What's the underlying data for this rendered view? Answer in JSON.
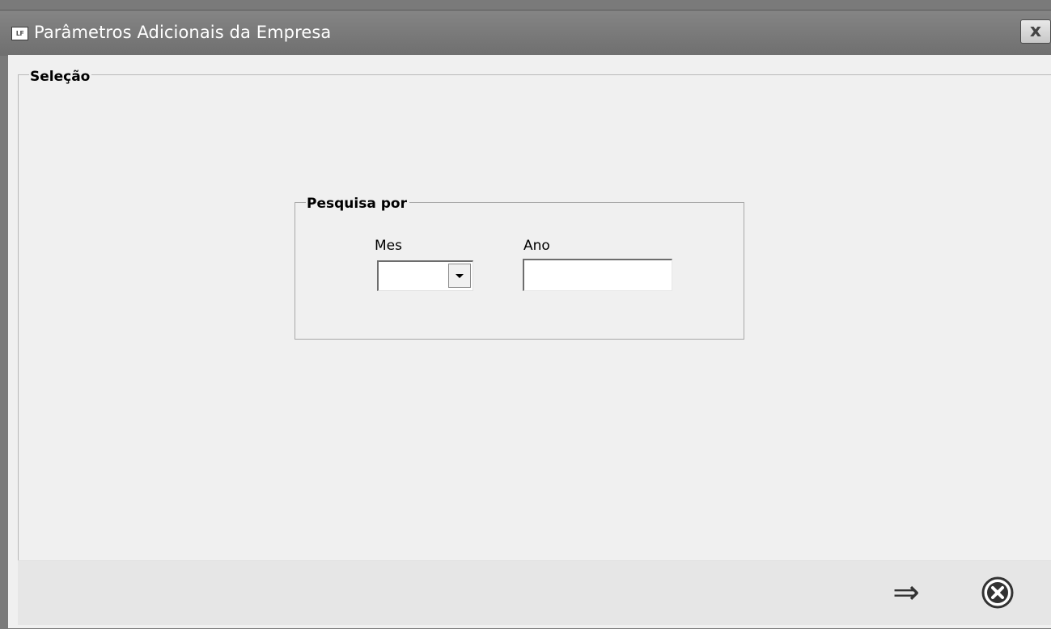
{
  "window": {
    "app_icon_text": "LF",
    "title": "Parâmetros Adicionais da Empresa",
    "close_label": "x"
  },
  "selection_group": {
    "legend": "Seleção",
    "search_group": {
      "legend": "Pesquisa por",
      "month": {
        "label": "Mes",
        "value": ""
      },
      "year": {
        "label": "Ano",
        "value": ""
      }
    }
  },
  "footer": {
    "next_icon": "arrow-right-icon",
    "next_glyph": "⇒",
    "cancel_icon": "close-circle-icon"
  }
}
